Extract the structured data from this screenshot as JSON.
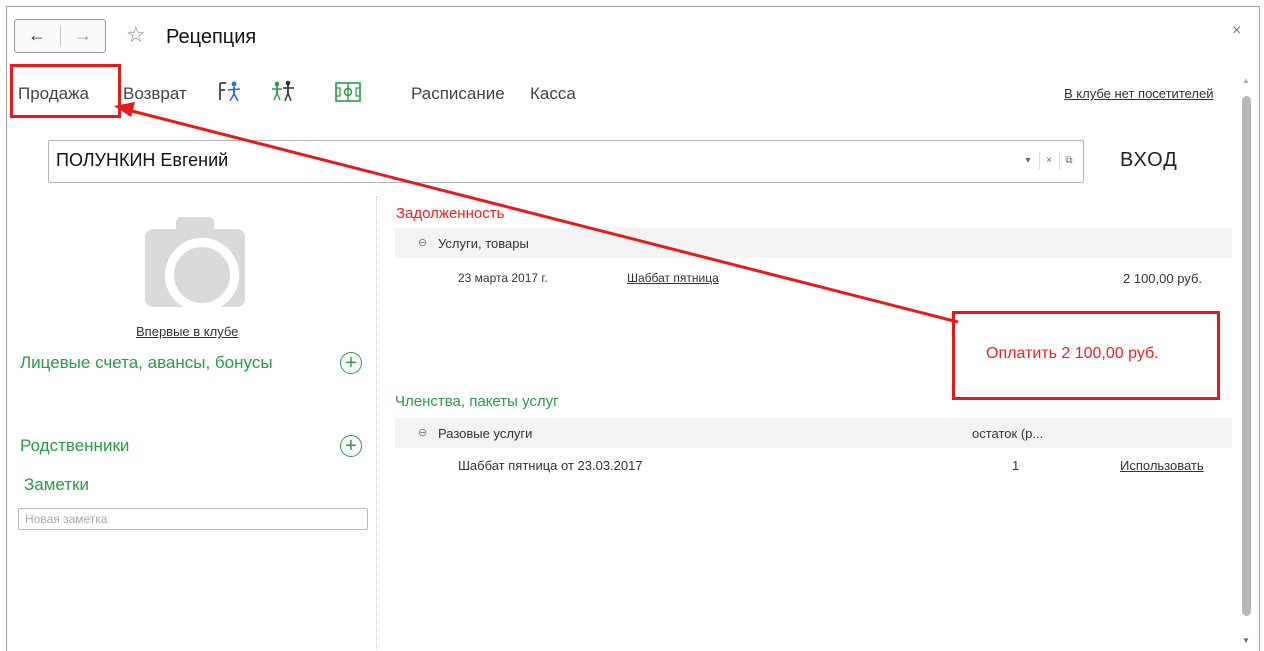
{
  "window": {
    "title": "Рецепция",
    "back_icon": "arrow-left-icon",
    "forward_icon": "arrow-right-icon",
    "favorite_icon": "star-icon",
    "close_icon": "close-icon"
  },
  "toolbar": {
    "sale": "Продажа",
    "return": "Возврат",
    "schedule": "Расписание",
    "cash": "Касса",
    "club_status": "В клубе нет посетителей"
  },
  "client": {
    "name": "ПОЛУНКИН Евгений",
    "entry_label": "ВХОД",
    "first_visit": "Впервые в клубе"
  },
  "left_sections": {
    "accounts": "Лицевые счета, авансы, бонусы",
    "relatives": "Родственники",
    "notes": "Заметки",
    "note_placeholder": "Новая заметка"
  },
  "debt": {
    "title": "Задолженность",
    "group": "Услуги, товары",
    "items": [
      {
        "date": "23 марта 2017 г.",
        "name": "Шаббат пятница",
        "amount": "2 100,00 руб."
      }
    ],
    "pay_label": "Оплатить 2 100,00 руб."
  },
  "memberships": {
    "title": "Членства, пакеты услуг",
    "group": "Разовые услуги",
    "remaining_header": "остаток (р...",
    "items": [
      {
        "name": "Шаббат пятница  от 23.03.2017",
        "remaining": "1",
        "action": "Использовать"
      }
    ]
  },
  "colors": {
    "accent_green": "#2a9a4a",
    "alert_red": "#e31b1b"
  }
}
